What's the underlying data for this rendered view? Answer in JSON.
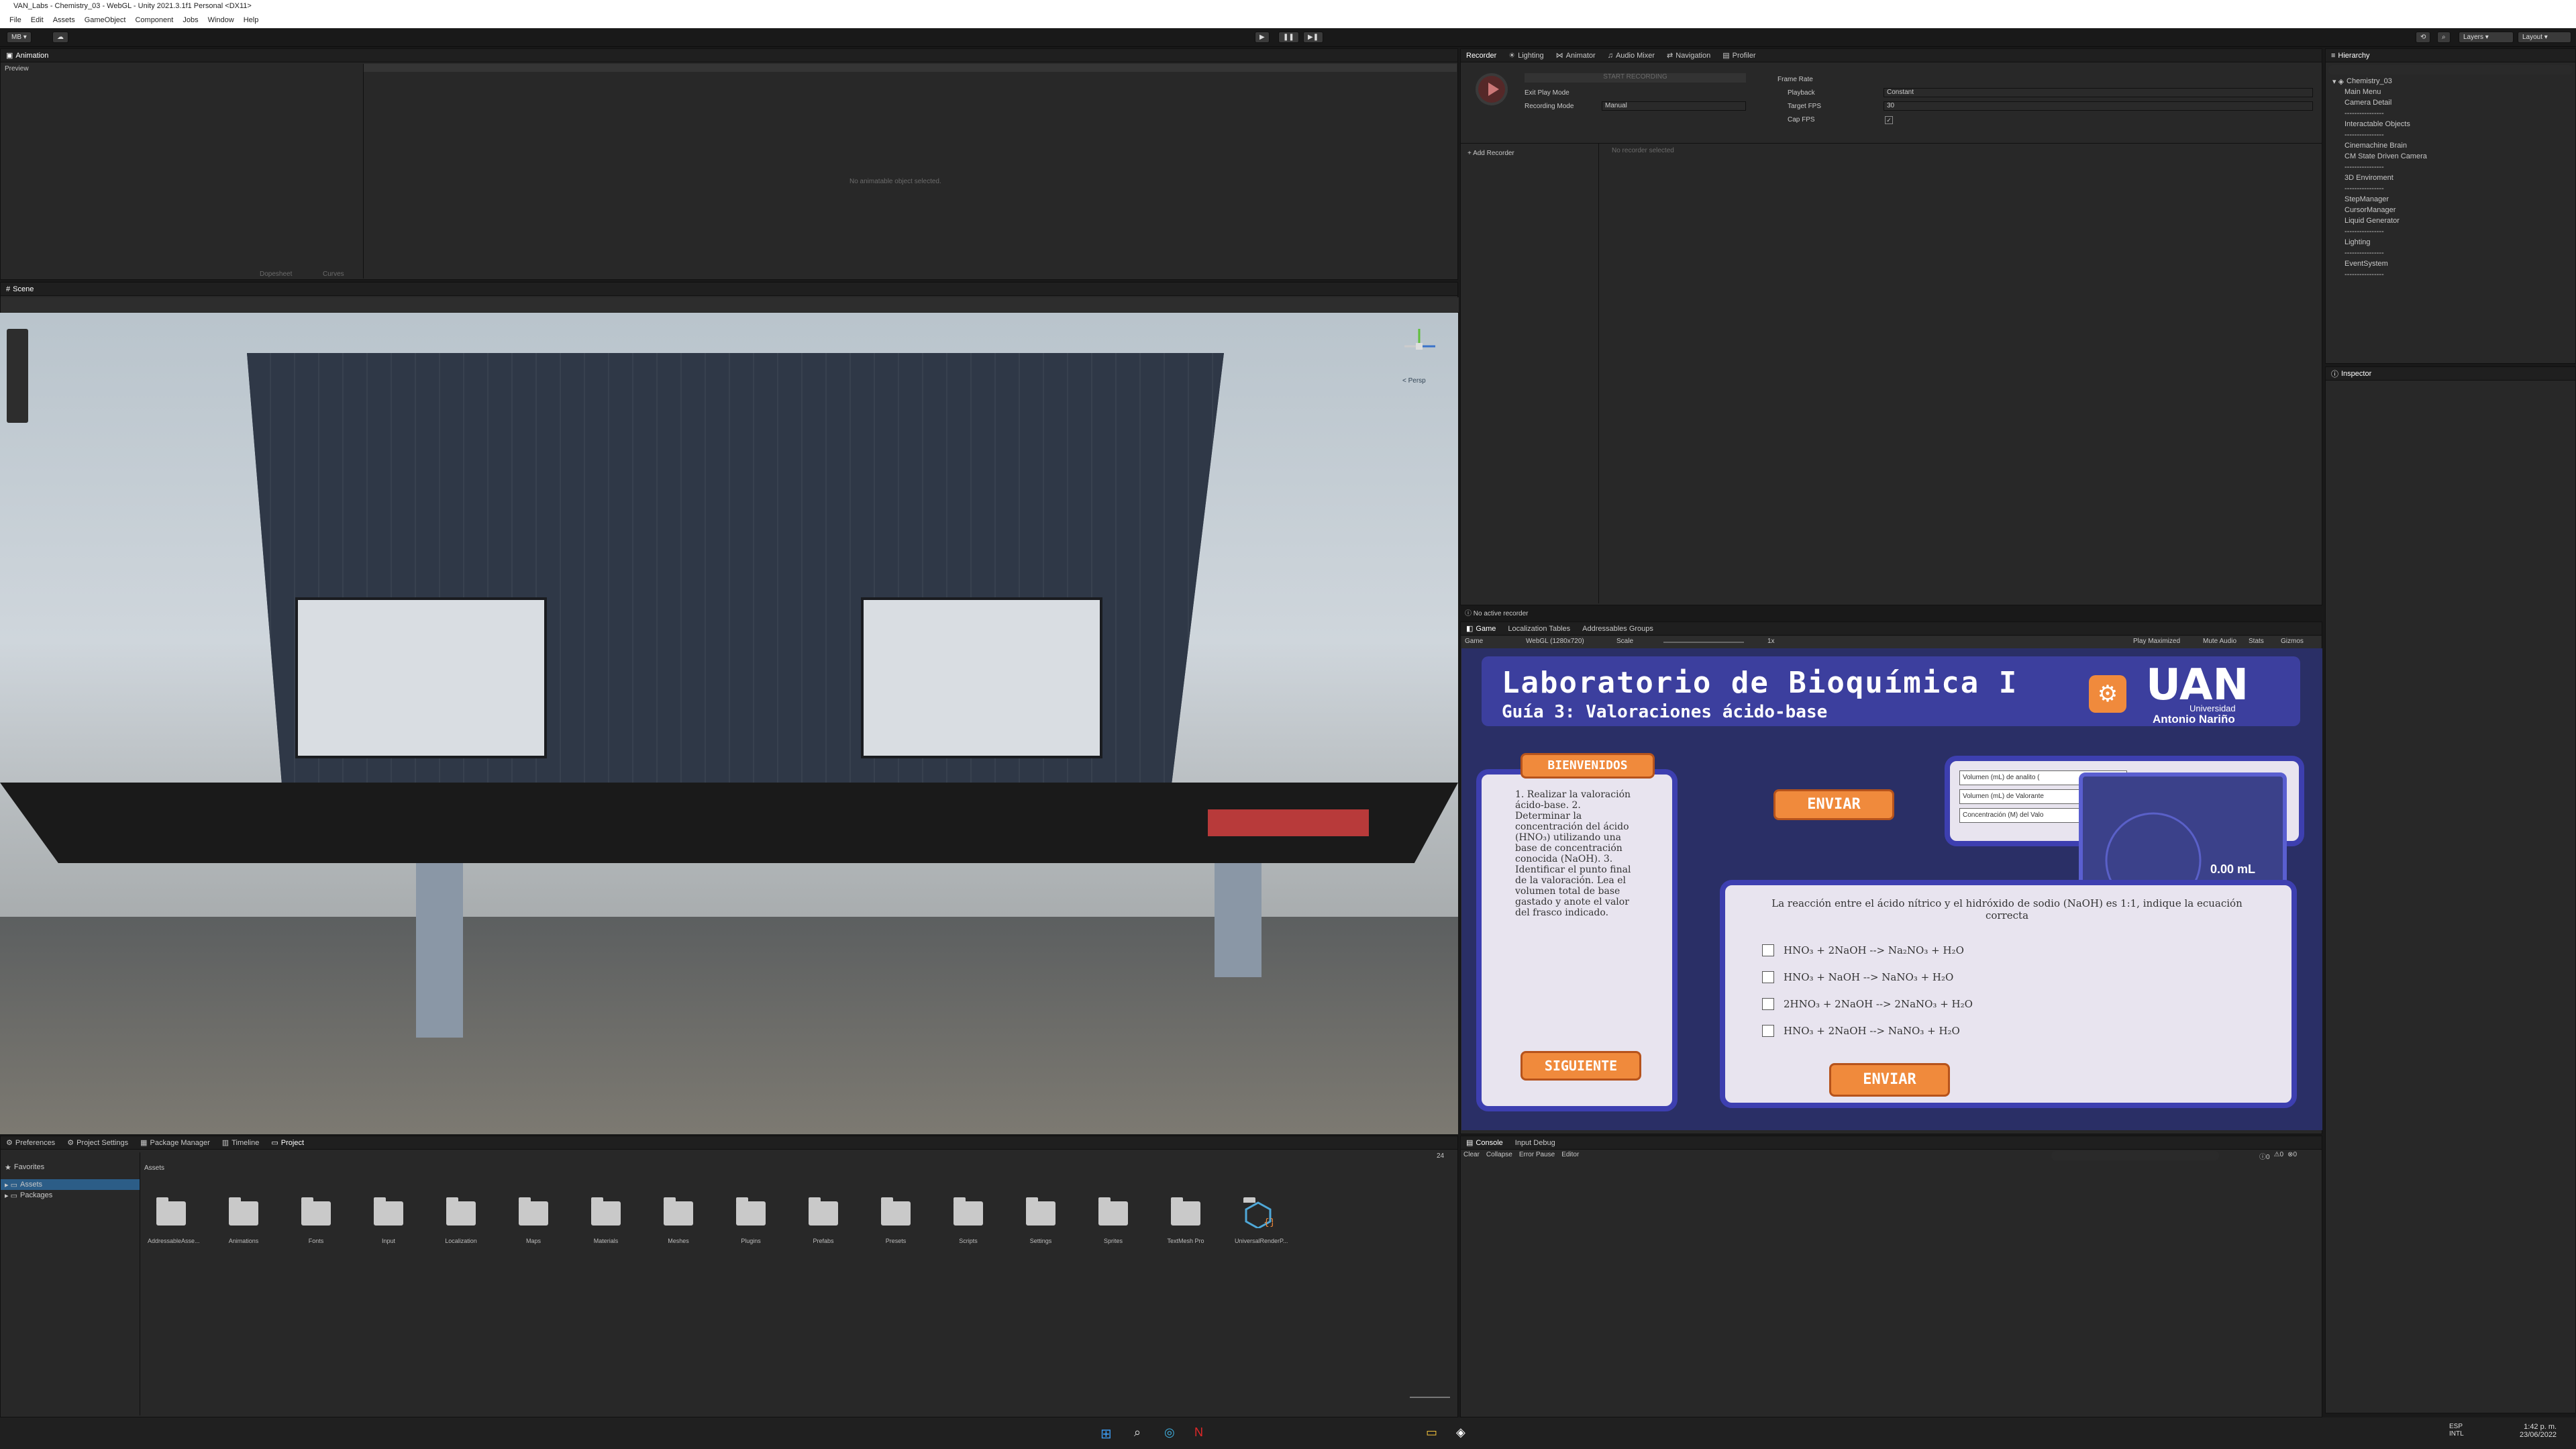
{
  "window": {
    "title": "VAN_Labs - Chemistry_03 - WebGL - Unity 2021.3.1f1 Personal <DX11>"
  },
  "menu": [
    "File",
    "Edit",
    "Assets",
    "GameObject",
    "Component",
    "Jobs",
    "Window",
    "Help"
  ],
  "toolbar": {
    "account": "MB",
    "layers": "Layers",
    "layout": "Layout"
  },
  "animation": {
    "tab": "Animation",
    "preview": "Preview",
    "empty": "No animatable object selected.",
    "dopesheet": "Dopesheet",
    "curves": "Curves"
  },
  "recorder": {
    "tabs": [
      "Recorder",
      "Lighting",
      "Animator",
      "Audio Mixer",
      "Navigation",
      "Profiler"
    ],
    "start": "START RECORDING",
    "exit_play_mode": "Exit Play Mode",
    "recording_mode_label": "Recording Mode",
    "recording_mode": "Manual",
    "frame_rate": "Frame Rate",
    "playback_label": "Playback",
    "playback": "Constant",
    "target_fps_label": "Target FPS",
    "target_fps": "30",
    "cap_fps_label": "Cap FPS",
    "add_recorder": "+ Add Recorder",
    "none_selected": "No recorder selected",
    "no_active": "No active recorder"
  },
  "hierarchy": {
    "tab": "Hierarchy",
    "root": "Chemistry_03",
    "items": [
      "Main Menu",
      "Camera Detail",
      "----------------",
      "Interactable Objects",
      "----------------",
      "Cinemachine Brain",
      "CM State Driven Camera",
      "----------------",
      "3D Enviroment",
      "----------------",
      "StepManager",
      "CursorManager",
      "Liquid Generator",
      "----------------",
      "Lighting",
      "----------------",
      "EventSystem",
      "----------------"
    ]
  },
  "inspector": {
    "tab": "Inspector"
  },
  "scene": {
    "tab": "Scene",
    "persp": "< Persp"
  },
  "game": {
    "tabs": [
      "Game",
      "Localization Tables",
      "Addressables Groups"
    ],
    "display": "Game",
    "resolution": "WebGL (1280x720)",
    "scale_label": "Scale",
    "scale": "1x",
    "play_maximized": "Play Maximized",
    "mute_audio": "Mute Audio",
    "stats": "Stats",
    "gizmos": "Gizmos",
    "title": "Laboratorio de Bioquímica I",
    "subtitle": "Guía 3: Valoraciones ácido-base",
    "logo_main": "UAN",
    "logo_sub1": "Universidad",
    "logo_sub2": "Antonio Nariño",
    "welcome": "BIENVENIDOS",
    "welcome_text": "1. Realizar la valoración ácido-base. 2. Determinar la concentración del ácido (HNO₃) utilizando una base de concentración conocida (NaOH). 3. Identificar el punto final de la valoración. Lea el volumen total de base gastado y anote el valor del frasco indicado.",
    "siguiente": "SIGUIENTE",
    "enviar": "ENVIAR",
    "table_rows": [
      "Volumen (mL) de analito (",
      "Volumen (mL) de Valorante",
      "Concentración (M) del Valo"
    ],
    "reading": "0.00 mL",
    "question": "La reacción entre el ácido nítrico y el hidróxido de sodio (NaOH) es 1:1, indique la ecuación correcta",
    "options": [
      "HNO₃ + 2NaOH --> Na₂NO₃ + H₂O",
      "HNO₃ + NaOH --> NaNO₃ + H₂O",
      "2HNO₃ + 2NaOH --> 2NaNO₃ + H₂O",
      "HNO₃ + 2NaOH --> NaNO₃ + H₂O"
    ]
  },
  "project": {
    "tabs": [
      "Preferences",
      "Project Settings",
      "Package Manager",
      "Timeline",
      "Project"
    ],
    "favorites": "Favorites",
    "assets": "Assets",
    "packages": "Packages",
    "breadcrumb": "Assets",
    "folders": [
      "AddressableAsse...",
      "Animations",
      "Fonts",
      "Input",
      "Localization",
      "Maps",
      "Materials",
      "Meshes",
      "Plugins",
      "Prefabs",
      "Presets",
      "Scripts",
      "Settings",
      "Sprites",
      "TextMesh Pro",
      "UniversalRenderP..."
    ],
    "zoom_count": "24"
  },
  "console": {
    "tabs": [
      "Console",
      "Input Debug"
    ],
    "buttons": [
      "Clear",
      "Collapse",
      "Error Pause",
      "Editor"
    ],
    "counts": [
      "0",
      "0",
      "0"
    ]
  },
  "taskbar": {
    "lang": "ESP",
    "lang2": "INTL",
    "time": "1:42 p. m.",
    "date": "23/06/2022"
  },
  "colors": {
    "accent_orange": "#f08a3c",
    "game_bg": "#2a2f66",
    "card_border": "#3d3fb0"
  }
}
